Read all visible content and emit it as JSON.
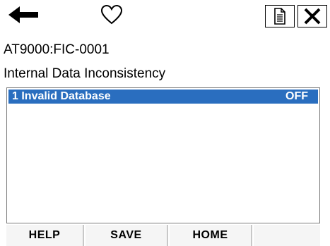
{
  "header": {
    "back_icon": "arrow-left-icon",
    "favorite_icon": "heart-outline-icon",
    "document_icon": "document-icon",
    "close_icon": "close-x-icon"
  },
  "device": {
    "tag": "AT9000:FIC-0001"
  },
  "screen": {
    "title": "Internal Data Inconsistency"
  },
  "list": {
    "items": [
      {
        "label": "1 Invalid Database",
        "value": "OFF",
        "selected": true
      }
    ]
  },
  "softkeys": {
    "key1": "HELP",
    "key2": "SAVE",
    "key3": "HOME",
    "key4": ""
  },
  "colors": {
    "selection": "#2a6ebf",
    "softkey_bg": "#f5f5f5",
    "softkey_divider": "#c8c8c8",
    "list_border": "#7a7a7a"
  }
}
